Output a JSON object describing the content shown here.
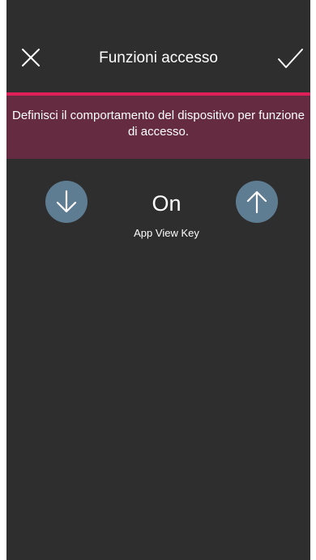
{
  "header": {
    "title": "Funzioni accesso",
    "close_icon": "close-icon",
    "confirm_icon": "checkmark-icon"
  },
  "banner": {
    "text": "Definisci il comportamento del dispositivo per funzione di accesso."
  },
  "selector": {
    "value": "On",
    "label": "App View Key",
    "decrease_icon": "arrow-down-icon",
    "increase_icon": "arrow-up-icon"
  },
  "colors": {
    "background": "#2e2e2e",
    "accent": "#e01f58",
    "banner": "#652b40",
    "button": "#5e7d93"
  }
}
